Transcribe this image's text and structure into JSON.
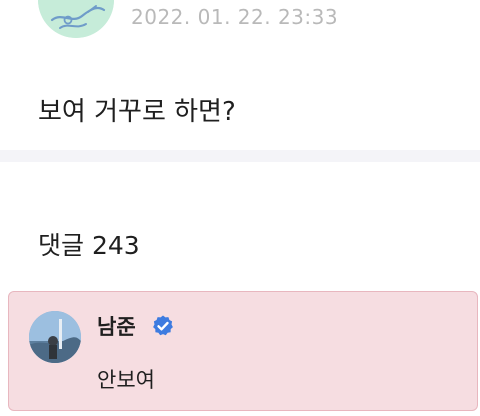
{
  "post": {
    "avatar_icon": "profile-avatar",
    "date": "2022. 01. 22. 23:33",
    "body": "보여 거꾸로 하면?"
  },
  "comments": {
    "heading": "댓글 243",
    "items": [
      {
        "author": "남준",
        "verified": true,
        "verified_icon": "verified-badge-icon",
        "text": "안보여",
        "highlighted": true
      }
    ]
  },
  "colors": {
    "date_text": "#b9b9b9",
    "divider": "#f4f4f8",
    "highlight_bg": "#f6dde1",
    "highlight_border": "#e8b7bf",
    "verified": "#3d7be0",
    "avatar_bg": "#c6ecd9"
  }
}
